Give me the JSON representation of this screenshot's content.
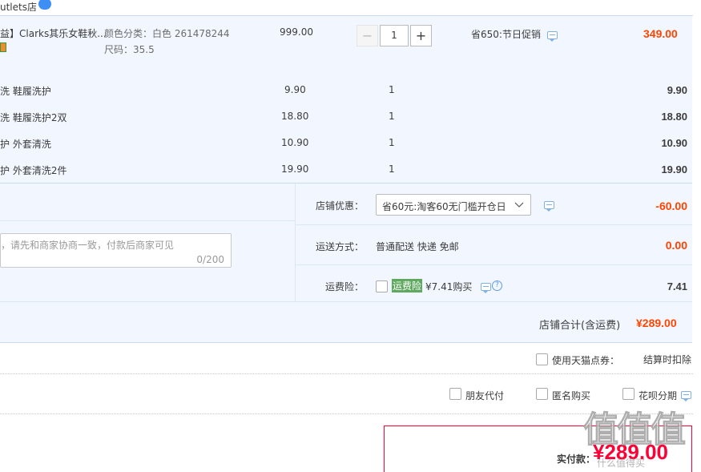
{
  "shop": {
    "name": "utlets店",
    "badge": ""
  },
  "main_item": {
    "prefix": "益】",
    "title": "Clarks其乐女鞋秋...",
    "color_spec": "颜色分类：白色 261478244",
    "size_spec": "尺码：35.5",
    "unit_price": "999.00",
    "quantity": "1",
    "minus": "−",
    "plus": "+",
    "promo": "省650:节日促销",
    "subtotal": "349.00"
  },
  "services": [
    {
      "name": "洗 鞋履洗护",
      "price": "9.90",
      "qty": "1",
      "total": "9.90"
    },
    {
      "name": "洗 鞋履洗护2双",
      "price": "18.80",
      "qty": "1",
      "total": "18.80"
    },
    {
      "name": "护 外套清洗",
      "price": "10.90",
      "qty": "1",
      "total": "10.90"
    },
    {
      "name": "护 外套清洗2件",
      "price": "19.90",
      "qty": "1",
      "total": "19.90"
    }
  ],
  "message_box": {
    "placeholder": "，请先和商家协商一致，付款后商家可见",
    "counter": "0/200"
  },
  "shop_discount": {
    "label": "店铺优惠：",
    "selected": "省60元:淘客60无门槛开仓日",
    "amount": "-60.00"
  },
  "shipping": {
    "label": "运送方式：",
    "value": "普通配送 快递 免邮",
    "amount": "0.00"
  },
  "insurance": {
    "label": "运费险：",
    "tag": "运费险",
    "price_text": "¥7.41购买",
    "help": "?",
    "amount": "7.41"
  },
  "shop_total": {
    "label": "店铺合计(含运费)",
    "amount": "¥289.00"
  },
  "tmall_points": {
    "label": "使用天猫点券：",
    "note": "结算时扣除"
  },
  "options": {
    "friend_pay": "朋友代付",
    "anonymous": "匿名购买",
    "huabei": "花呗分期"
  },
  "payment": {
    "label": "实付款：",
    "amount": "¥289.00"
  },
  "watermark": {
    "text": "值值值",
    "sub": "什么值得买"
  },
  "colors": {
    "accent_red": "#ff0036",
    "price_orange": "#f40",
    "light_blue_bg": "#f2f7ff",
    "green_tag": "#5fa85f"
  }
}
